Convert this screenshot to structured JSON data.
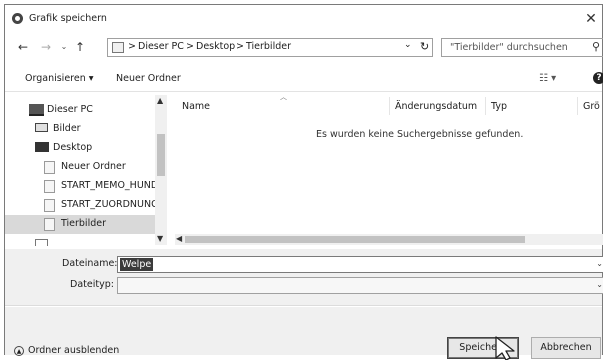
{
  "window": {
    "title": "Grafik speichern",
    "close_label": "✕"
  },
  "address": {
    "breadcrumb": [
      "Dieser PC",
      "Desktop",
      "Tierbilder"
    ],
    "separator": ">",
    "search_placeholder": "\"Tierbilder\" durchsuchen"
  },
  "toolbar": {
    "organize_label": "Organisieren ▾",
    "new_folder_label": "Neuer Ordner"
  },
  "nav_tree": [
    {
      "label": "Dieser PC"
    },
    {
      "label": "Bilder"
    },
    {
      "label": "Desktop"
    },
    {
      "label": "Neuer Ordner"
    },
    {
      "label": "START_MEMO_HUND"
    },
    {
      "label": "START_ZUORDNUNG"
    },
    {
      "label": "Tierbilder"
    }
  ],
  "columns": {
    "name": "Name",
    "date": "Änderungsdatum",
    "type": "Typ",
    "size": "Grö"
  },
  "empty_message": "Es wurden keine Suchergebnisse gefunden.",
  "fields": {
    "filename_label": "Dateiname:",
    "filename_value": "Welpe",
    "filetype_label": "Dateityp:",
    "filetype_value": ""
  },
  "footer": {
    "hide_folders_label": "Ordner ausblenden",
    "save_label": "Speichern",
    "cancel_label": "Abbrechen"
  },
  "colors": {
    "selection": "#3b3b3b",
    "panel": "#f0f0f0",
    "tree_selected": "#d9d9d9"
  }
}
